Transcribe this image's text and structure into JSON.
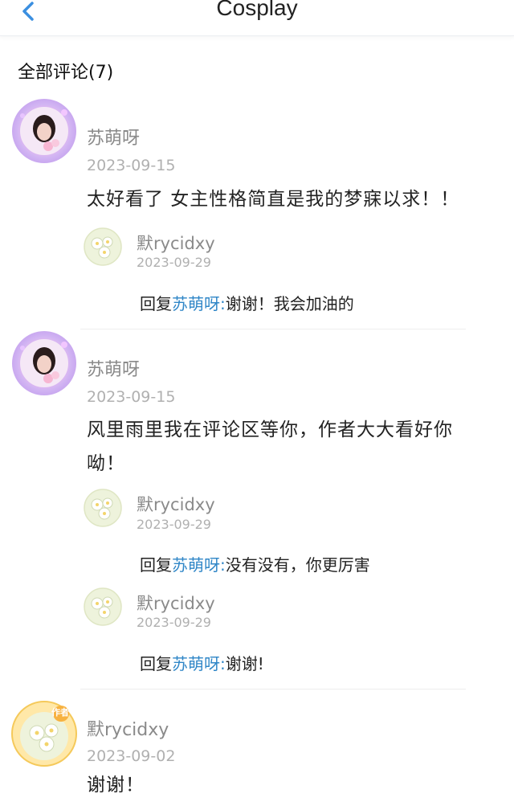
{
  "header": {
    "title": "Cosplay",
    "back_icon": "chevron-left-icon",
    "accent": "#3b8fe0"
  },
  "section": {
    "title": "全部评论(7)"
  },
  "comments": [
    {
      "author": "苏萌呀",
      "date": "2023-09-15",
      "content": "太好看了 女主性格简直是我的梦寐以求！！",
      "replies": [
        {
          "author": "默rycidxy",
          "date": "2023-09-29",
          "prefix": "回复",
          "target": "苏萌呀:",
          "text": "谢谢！我会加油的"
        }
      ]
    },
    {
      "author": "苏萌呀",
      "date": "2023-09-15",
      "content": "风里雨里我在评论区等你，作者大大看好你呦！",
      "replies": [
        {
          "author": "默rycidxy",
          "date": "2023-09-29",
          "prefix": "回复",
          "target": "苏萌呀:",
          "text": "没有没有，你更厉害"
        },
        {
          "author": "默rycidxy",
          "date": "2023-09-29",
          "prefix": "回复",
          "target": "苏萌呀:",
          "text": "谢谢!"
        }
      ]
    },
    {
      "author": "默rycidxy",
      "date": "2023-09-02",
      "content": "谢谢！",
      "badge": "作者",
      "replies": []
    }
  ]
}
